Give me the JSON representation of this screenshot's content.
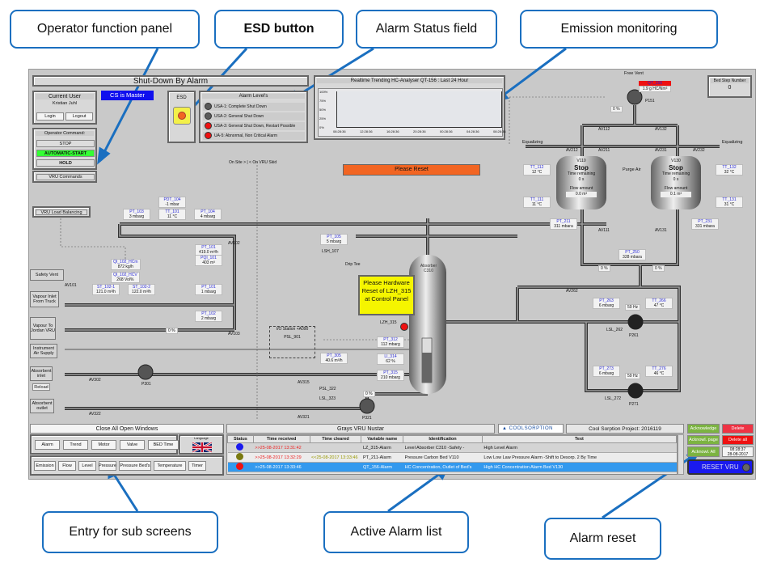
{
  "callouts": {
    "operator": "Operator function panel",
    "esd": "ESD button",
    "alarm_status": "Alarm Status field",
    "emission": "Emission monitoring",
    "subscreens": "Entry for sub screens",
    "alarm_list": "Active Alarm list",
    "alarm_reset": "Alarm reset"
  },
  "header": {
    "title": "Shut-Down By Alarm",
    "master": "CS is Master"
  },
  "user": {
    "title": "Current User",
    "name": "Kristian Juhl",
    "login": "Login",
    "logout": "Logout"
  },
  "operator": {
    "title": "Operator Command:",
    "stop": "STOP",
    "auto": "AUTOMATIC-START",
    "hold": "HOLD",
    "vru": "VRU Commands"
  },
  "esd": {
    "label": "ESD"
  },
  "alarm_levels": {
    "title": "Alarm Level's",
    "items": [
      {
        "text": "USA-1: Complete Shut Down",
        "color": "#5a5a5a"
      },
      {
        "text": "USA-2: General Shut Down",
        "color": "#5a5a5a"
      },
      {
        "text": "USA-3: General Shut Down, Restart Possible",
        "color": "#ee1111"
      },
      {
        "text": "UA-5: Abnormal, Non Critical Alarm",
        "color": "#ee1111"
      }
    ]
  },
  "trend": {
    "title": "Realtime Trending HC-Analyser QT-156 : Last 24 Hour",
    "yticks": [
      "100%",
      "75%",
      "50%",
      "25%",
      "0%"
    ],
    "xticks": [
      "08:28:36",
      "12:28:36",
      "16:28:36",
      "20:28:36",
      "00:28:36",
      "04:28:36",
      "08:28:36"
    ]
  },
  "please_reset": "Please Reset",
  "bed_step": {
    "label": "Bed Step Number",
    "value": "0"
  },
  "site": "On Site > | < On VRU Skid",
  "hardware_reset": "Please Hardware Reset of LZH_315 at Control Panel",
  "left_boxes": {
    "load_balancing": "VRU Load Balancing",
    "safety_vent": "Safety Vent",
    "vapour_inlet": "Vapour Inlet From Truck",
    "vapour_to": "Vapour To Jordan VRU",
    "instrument_air": "Instrument Air Supply",
    "absorbent_inlet": "Absorbent inlet",
    "reload": "Reload",
    "absorbent_outlet": "Absorbent outlet"
  },
  "io_station": {
    "title": "I/O Station +A090",
    "sensor": "PSL_901"
  },
  "absorber": "Absorber C310",
  "vessels": [
    {
      "name": "V110",
      "state": "Stop",
      "time_label": "Time remaining",
      "time": "0 s",
      "flow_label": "Flow amount",
      "flow": "0.0 m³"
    },
    {
      "name": "V130",
      "state": "Stop",
      "time_label": "Time remaining",
      "time": "0 s",
      "flow_label": "Flow amount",
      "flow": "0.1 m³"
    }
  ],
  "emission": {
    "tag": "QT_156",
    "value": "1.9 g HC/Nm³",
    "free_vent": "Free Vent",
    "purge": "Purge Air",
    "equalizing": "Equalizing",
    "status_color": "#ee1111"
  },
  "tags": [
    {
      "tag": "PDT_104",
      "value": "-1 mbar"
    },
    {
      "tag": "PT_103",
      "value": "3 mbarg"
    },
    {
      "tag": "TT_101",
      "value": "11 °C"
    },
    {
      "tag": "PT_104",
      "value": "4 mbarg"
    },
    {
      "tag": "PT_101",
      "value": "419.0 m³/h"
    },
    {
      "tag": "PQI_101",
      "value": "403 m³"
    },
    {
      "tag": "QI_102_HCm",
      "value": "872 kg/h"
    },
    {
      "tag": "QI_102_HCV",
      "value": "268 Vol%"
    },
    {
      "tag": "ST_102-1",
      "value": "121.0 m³/h"
    },
    {
      "tag": "ST_102-2",
      "value": "122.0 m³/h"
    },
    {
      "tag": "PT_101",
      "value": "1 mbarg"
    },
    {
      "tag": "PT_102",
      "value": "2 mbarg"
    },
    {
      "tag": "PT_105",
      "value": "5 mbarg"
    },
    {
      "tag": "PT_312",
      "value": "112 mbarg"
    },
    {
      "tag": "LI_314",
      "value": "62 %"
    },
    {
      "tag": "PT_315",
      "value": "210 mbarg"
    },
    {
      "tag": "PT_305",
      "value": "40.6 m³/h"
    },
    {
      "tag": "TT_112",
      "value": "12 °C"
    },
    {
      "tag": "TT_111",
      "value": "11 °C"
    },
    {
      "tag": "TT_132",
      "value": "32 °C"
    },
    {
      "tag": "TT_131",
      "value": "31 °C"
    },
    {
      "tag": "PT_211",
      "value": "311 mbara"
    },
    {
      "tag": "PT_231",
      "value": "331 mbara"
    },
    {
      "tag": "PT_250",
      "value": "328 mbara"
    },
    {
      "tag": "PT_263",
      "value": "6 mbarg"
    },
    {
      "tag": "TT_266",
      "value": "47 °C"
    },
    {
      "tag": "PT_273",
      "value": "6 mbarg"
    },
    {
      "tag": "TT_276",
      "value": "46 °C"
    }
  ],
  "labels": [
    "AV101",
    "AV102",
    "AV103",
    "AV302",
    "AV322",
    "P301",
    "AV315",
    "AV321",
    "P321",
    "LSH_107",
    "Drip Tee",
    "LZH_315",
    "PSL_322",
    "LSL_323",
    "AV112",
    "AV132",
    "AV212",
    "AV211",
    "AV231",
    "AV232",
    "AV111",
    "AV131",
    "P151",
    "AV262",
    "LSL_262",
    "P261",
    "LSL_272",
    "P271"
  ],
  "readouts": [
    "0 %",
    "0 %",
    "0 %",
    "0 %",
    "0 %",
    "59 Hz",
    "59 Hz"
  ],
  "sub": {
    "close": "Close All Open Windows",
    "row1": [
      "Alarm",
      "Trend",
      "Motor",
      "Valve",
      "BED Time"
    ],
    "language": "Language",
    "row2": [
      "Emission",
      "Flow",
      "Level",
      "Pressure",
      "Pressure Bed's",
      "Temperature",
      "Timer"
    ]
  },
  "alarms": {
    "title": "Grays VRU Nustar",
    "logo": "COOLSORPTION",
    "project": "Cool Sorption Project: 2016119",
    "columns": [
      "Status",
      "Time received",
      "Time cleared",
      "Variable name",
      "Identification",
      "Text"
    ],
    "rows": [
      {
        "color": "#1a1aee",
        "received": ">>25-08-2017 13:31:42",
        "cleared": "",
        "var": "LZ_315-Alarm",
        "ident": "Level Absorber C310 -Safety -",
        "text": "High Level Alarm"
      },
      {
        "color": "#7a7a10",
        "received": ">>25-08-2017 13:32:29",
        "cleared": "<<25-08-2017 13:33:46",
        "var": "PT_211-Alarm",
        "ident": "Pressure Carbon Bed V110",
        "text": "Low Low Law Pressure Alarm -Shift to Desorp. 2 By Time"
      },
      {
        "color": "#ee1111",
        "received": ">>25-08-2017 13:33:46",
        "cleared": "",
        "var": "QT_156-Alarm",
        "ident": "HC Concentration, Outlet of Bed's",
        "text": "High HC Concentration Alarm Bed V130"
      }
    ]
  },
  "alarm_buttons": {
    "ack": "Acknowledge",
    "delete": "Delete",
    "ack_page": "Acknowl. page",
    "delete_all": "Delete all",
    "ack_all": "Acknowl. All",
    "time": "08:28:37",
    "date": "28-08-2017",
    "reset": "RESET VRU"
  }
}
